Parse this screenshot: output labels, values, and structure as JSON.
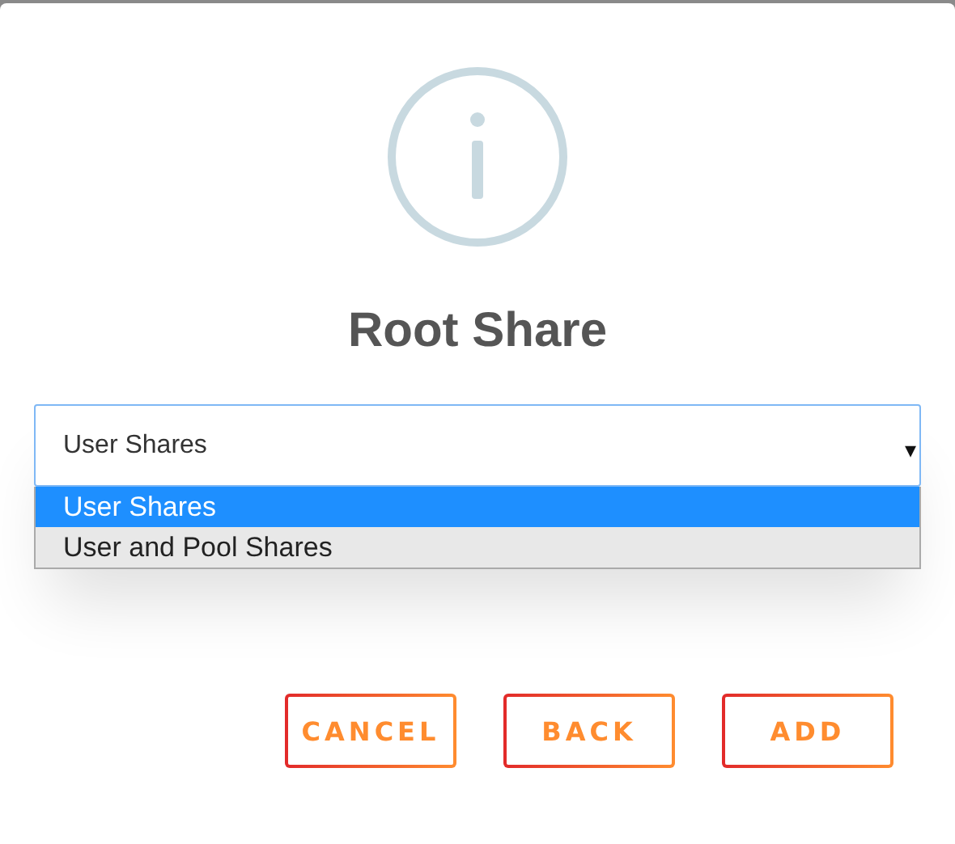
{
  "dialog": {
    "title": "Root Share"
  },
  "select": {
    "value": "User Shares",
    "expanded": true,
    "arrow": "▾",
    "options": [
      {
        "label": "User Shares",
        "selected": true
      },
      {
        "label": "User and Pool Shares",
        "selected": false
      }
    ]
  },
  "buttons": [
    {
      "label": "CANCEL"
    },
    {
      "label": "BACK"
    },
    {
      "label": "ADD"
    }
  ]
}
